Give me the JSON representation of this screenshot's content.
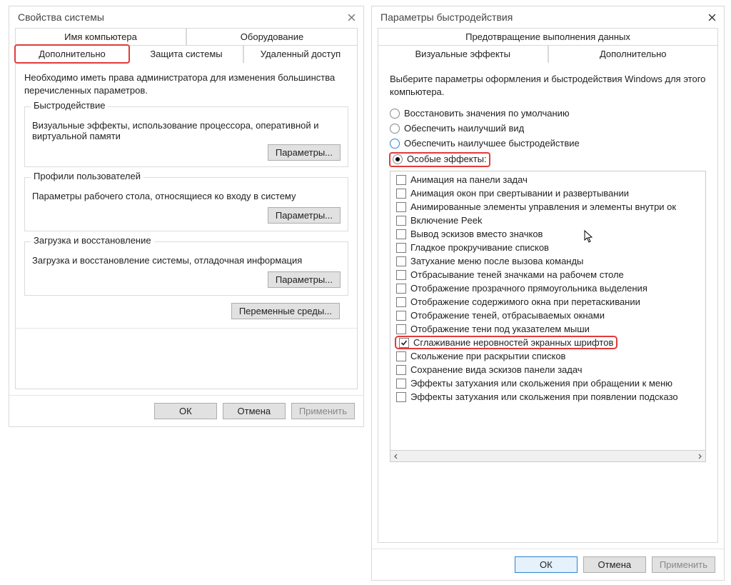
{
  "sys": {
    "title": "Свойства системы",
    "tabs_row1": [
      "Имя компьютера",
      "Оборудование"
    ],
    "tabs_row2": [
      "Дополнительно",
      "Защита системы",
      "Удаленный доступ"
    ],
    "intro": "Необходимо иметь права администратора для изменения большинства перечисленных параметров.",
    "perf": {
      "title": "Быстродействие",
      "desc": "Визуальные эффекты, использование процессора, оперативной и виртуальной памяти",
      "btn": "Параметры..."
    },
    "profiles": {
      "title": "Профили пользователей",
      "desc": "Параметры рабочего стола, относящиеся ко входу в систему",
      "btn": "Параметры..."
    },
    "startup": {
      "title": "Загрузка и восстановление",
      "desc": "Загрузка и восстановление системы, отладочная информация",
      "btn": "Параметры..."
    },
    "env_btn": "Переменные среды...",
    "footer": {
      "ok": "ОК",
      "cancel": "Отмена",
      "apply": "Применить"
    }
  },
  "perfopt": {
    "title": "Параметры быстродействия",
    "tabs_row1": [
      "Предотвращение выполнения данных"
    ],
    "tabs_row2": [
      "Визуальные эффекты",
      "Дополнительно"
    ],
    "intro": "Выберите параметры оформления и быстродействия Windows для этого компьютера.",
    "radios": [
      {
        "label": "Восстановить значения по умолчанию",
        "checked": false
      },
      {
        "label": "Обеспечить наилучший вид",
        "checked": false
      },
      {
        "label": "Обеспечить наилучшее быстродействие",
        "checked": false,
        "blue": true
      },
      {
        "label": "Особые эффекты:",
        "checked": true,
        "highlight": true
      }
    ],
    "effects": [
      {
        "label": "Анимация на панели задач",
        "checked": false
      },
      {
        "label": "Анимация окон при свертывании и развертывании",
        "checked": false
      },
      {
        "label": "Анимированные элементы управления и элементы внутри ок",
        "checked": false
      },
      {
        "label": "Включение Peek",
        "checked": false
      },
      {
        "label": "Вывод эскизов вместо значков",
        "checked": false
      },
      {
        "label": "Гладкое прокручивание списков",
        "checked": false
      },
      {
        "label": "Затухание меню после вызова команды",
        "checked": false
      },
      {
        "label": "Отбрасывание теней значками на рабочем столе",
        "checked": false
      },
      {
        "label": "Отображение прозрачного прямоугольника выделения",
        "checked": false
      },
      {
        "label": "Отображение содержимого окна при перетаскивании",
        "checked": false
      },
      {
        "label": "Отображение теней, отбрасываемых окнами",
        "checked": false
      },
      {
        "label": "Отображение тени под указателем мыши",
        "checked": false
      },
      {
        "label": "Сглаживание неровностей экранных шрифтов",
        "checked": true,
        "highlight": true
      },
      {
        "label": "Скольжение при раскрытии списков",
        "checked": false
      },
      {
        "label": "Сохранение вида эскизов панели задач",
        "checked": false
      },
      {
        "label": "Эффекты затухания или скольжения при обращении к меню",
        "checked": false
      },
      {
        "label": "Эффекты затухания или скольжения при появлении подсказо",
        "checked": false
      }
    ],
    "footer": {
      "ok": "ОК",
      "cancel": "Отмена",
      "apply": "Применить"
    }
  }
}
